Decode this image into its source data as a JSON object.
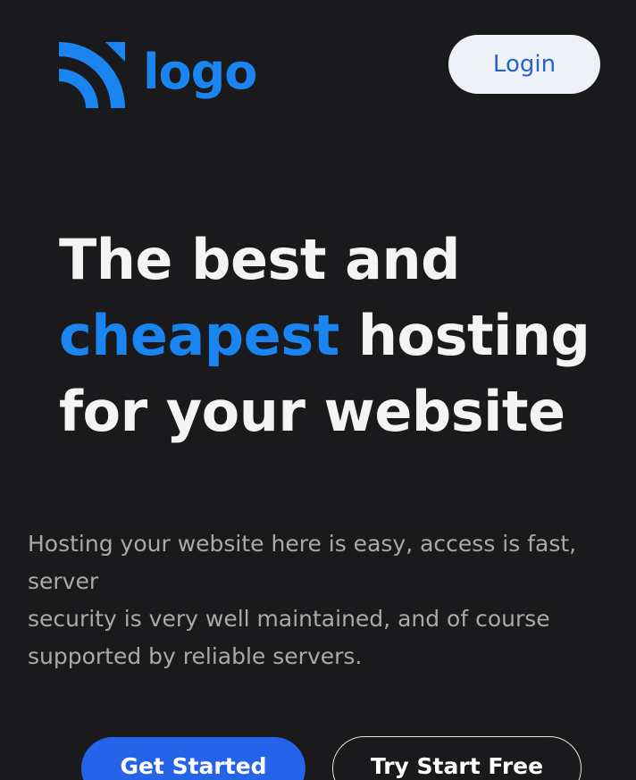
{
  "header": {
    "logo_text": "logo",
    "logo_icon": "signal-waves-icon",
    "login_label": "Login"
  },
  "hero": {
    "headline_line1": "The best and",
    "headline_accent": "cheapest",
    "headline_line2_rest": " hosting",
    "headline_line3": "for your website",
    "description_line1": "Hosting your website here is easy, access is fast, server",
    "description_line2": "security is very well maintained, and of course supported by reliable servers.",
    "primary_cta": "Get Started",
    "secondary_cta": "Try Start Free"
  },
  "colors": {
    "background": "#1a1a1d",
    "accent": "#1a85f0",
    "primary_button": "#2563e8",
    "login_background": "#eef2f8"
  }
}
